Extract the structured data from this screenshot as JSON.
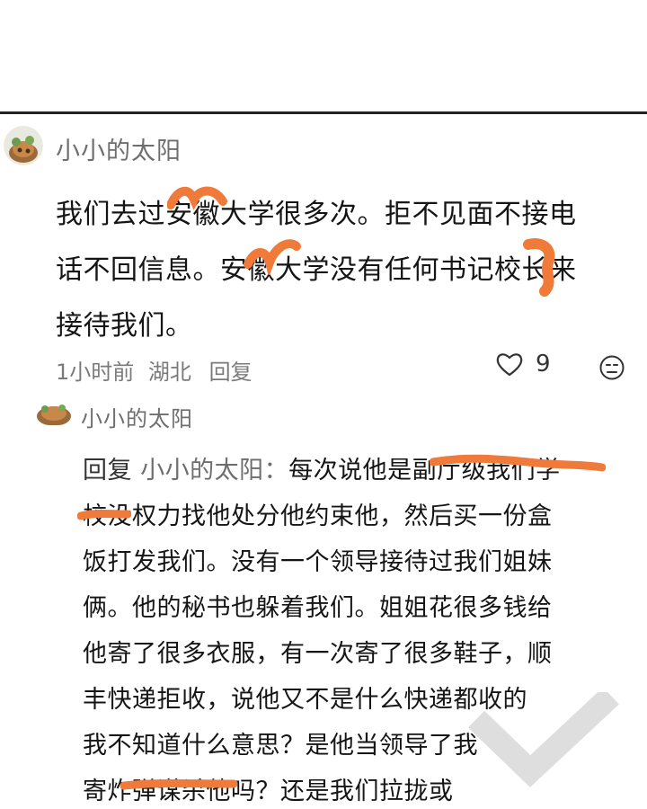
{
  "comment": {
    "username": "小小的太阳",
    "body": "我们去过安徽大学很多次。拒不见面不接电\n话不回信息。安徽大学没有任何书记校长来\n接待我们。",
    "time": "1小时前",
    "location": "湖北",
    "reply_label": "回复",
    "like_count": "9"
  },
  "reply": {
    "username": "小小的太阳",
    "prefix": "回复",
    "target": "小小的太阳：",
    "body": "每次说他是副厅级我们学\n校没权力找他处分他约束他，然后买一份盒\n饭打发我们。没有一个领导接待过我们姐妹\n俩。他的秘书也躲着我们。姐姐花很多钱给\n他寄了很多衣服，有一次寄了很多鞋子，顺\n丰快递拒收，说他又不是什么快递都收的\n我不知道什么意思？是他当领导了我\n寄炸弹谋杀他吗？还是我们拉拢或"
  },
  "colors": {
    "redaction": "#f07a3a",
    "meta": "#7a7a7a",
    "username": "#6e6e6e"
  },
  "icons": {
    "like": "heart-outline-icon",
    "emoji": "emoji-face-icon"
  }
}
